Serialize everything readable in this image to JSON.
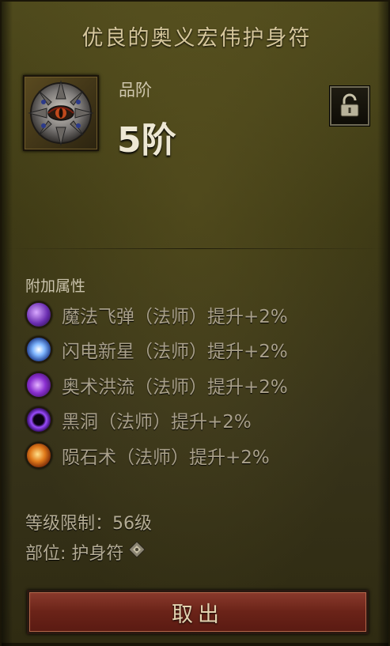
{
  "item": {
    "title": "优良的奥义宏伟护身符",
    "icon": "amulet-eye-icon",
    "grade_label": "品阶",
    "grade_value": "5阶",
    "lock_icon": "unlocked-padlock-icon"
  },
  "attributes": {
    "title": "附加属性",
    "items": [
      {
        "label": "魔法飞弹（法师）提升+2%",
        "icon": "magic-missile-icon"
      },
      {
        "label": "闪电新星（法师）提升+2%",
        "icon": "frost-nova-icon"
      },
      {
        "label": "奥术洪流（法师）提升+2%",
        "icon": "arcane-torrent-icon"
      },
      {
        "label": "黑洞（法师）提升+2%",
        "icon": "black-hole-icon"
      },
      {
        "label": "陨石术（法师）提升+2%",
        "icon": "meteor-icon"
      }
    ]
  },
  "requirements": {
    "level": "等级限制：56级",
    "slot": "部位: 护身符",
    "slot_icon": "amulet-slot-icon"
  },
  "actions": {
    "take_label": "取出"
  },
  "colors": {
    "panel_bg": "#3e3a15",
    "title": "#d6c79c",
    "button_red": "#6a2318"
  }
}
